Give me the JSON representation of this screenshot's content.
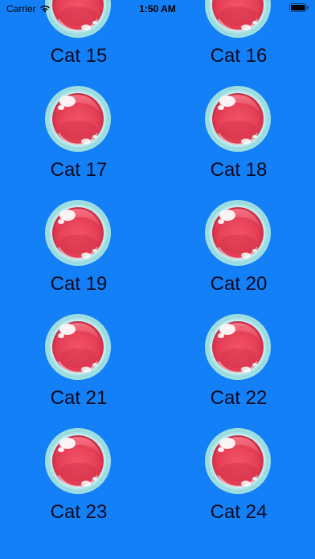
{
  "status_bar": {
    "carrier": "Carrier",
    "time": "1:50 AM",
    "wifi_icon": "wifi-icon",
    "battery_icon": "battery-icon"
  },
  "colors": {
    "background": "#1380f7",
    "bubble_red": "#e84258",
    "bubble_rim": "#b9ecec",
    "label_text": "#0b0b1f"
  },
  "cats": [
    {
      "label": "Cat 15",
      "icon": "red-bubble-icon"
    },
    {
      "label": "Cat 16",
      "icon": "red-bubble-icon"
    },
    {
      "label": "Cat 17",
      "icon": "red-bubble-icon"
    },
    {
      "label": "Cat 18",
      "icon": "red-bubble-icon"
    },
    {
      "label": "Cat 19",
      "icon": "red-bubble-icon"
    },
    {
      "label": "Cat 20",
      "icon": "red-bubble-icon"
    },
    {
      "label": "Cat 21",
      "icon": "red-bubble-icon"
    },
    {
      "label": "Cat 22",
      "icon": "red-bubble-icon"
    },
    {
      "label": "Cat 23",
      "icon": "red-bubble-icon"
    },
    {
      "label": "Cat 24",
      "icon": "red-bubble-icon"
    }
  ]
}
